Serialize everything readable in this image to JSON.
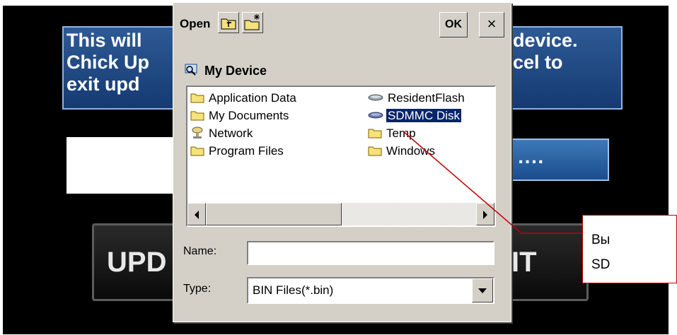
{
  "background_app": {
    "message_left_lines": [
      "This will",
      "Chick Up",
      "exit upd"
    ],
    "message_right_lines": [
      "device.",
      "cel to"
    ],
    "browse_label": "....",
    "update_button": "UPD",
    "exit_button": "IT"
  },
  "dialog": {
    "title": "Open",
    "ok_label": "OK",
    "close_label": "×",
    "location": "My Device",
    "items": [
      {
        "label": "Application Data",
        "icon": "folder-icon"
      },
      {
        "label": "My Documents",
        "icon": "folder-icon"
      },
      {
        "label": "Network",
        "icon": "network-icon"
      },
      {
        "label": "Program Files",
        "icon": "folder-icon"
      },
      {
        "label": "ResidentFlash",
        "icon": "drive-icon"
      },
      {
        "label": "SDMMC Disk",
        "icon": "drive-icon",
        "selected": true
      },
      {
        "label": "Temp",
        "icon": "folder-icon"
      },
      {
        "label": "Windows",
        "icon": "folder-icon"
      }
    ],
    "name_label": "Name:",
    "name_value": "",
    "type_label": "Type:",
    "type_value": "BIN Files(*.bin)"
  },
  "callout": {
    "line1": "Вы",
    "line2": "SD",
    "color": "#c00000"
  },
  "colors": {
    "selection": "#0a246a",
    "dialog_face": "#d4d0c8",
    "message_bg": "#1f4a85"
  }
}
